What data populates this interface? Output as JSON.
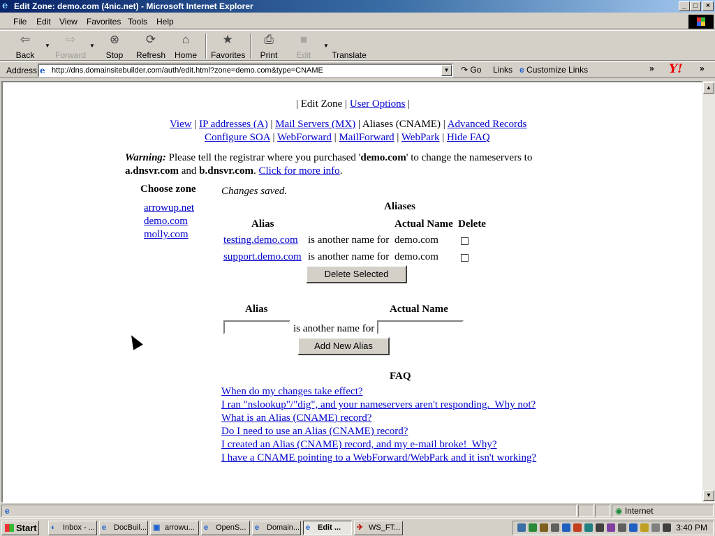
{
  "window": {
    "title": "Edit Zone: demo.com (4nic.net) - Microsoft Internet Explorer",
    "controls": [
      "_",
      "□",
      "×"
    ]
  },
  "menu": {
    "items": [
      "File",
      "Edit",
      "View",
      "Favorites",
      "Tools",
      "Help"
    ]
  },
  "toolbar": {
    "back": "Back",
    "forward": "Forward",
    "stop": "Stop",
    "refresh": "Refresh",
    "home": "Home",
    "favorites": "Favorites",
    "print": "Print",
    "edit": "Edit",
    "translate": "Translate"
  },
  "address": {
    "label": "Address",
    "url": "http://dns.domainsitebuilder.com/auth/edit.html?zone=demo.com&type=CNAME",
    "go": "Go",
    "links": "Links",
    "customize": "Customize Links"
  },
  "page": {
    "top_nav": {
      "sep1": "| Edit Zone |",
      "user_options": "User Options",
      "sep2": "|"
    },
    "nav": {
      "view": "View",
      "ip": "IP addresses (A)",
      "mx": "Mail Servers (MX)",
      "aliases": "Aliases (CNAME)",
      "advanced": "Advanced Records",
      "soa": "Configure SOA",
      "webforward": "WebForward",
      "mailforward": "MailForward",
      "webpark": "WebPark",
      "hidefaq": "Hide FAQ"
    },
    "warning": {
      "label": "Warning:",
      "text1": " Please tell the registrar where you purchased '",
      "domain": "demo.com",
      "text2": "' to change the nameservers to",
      "ns1": "a.dnsvr.com",
      "and": " and ",
      "ns2": "b.dnsvr.com",
      "period": ".",
      "more": "Click for more info"
    },
    "zones": {
      "heading": "Choose zone",
      "items": [
        "arrowup.net",
        "demo.com",
        "molly.com"
      ]
    },
    "status": "Changes saved.",
    "aliases_table": {
      "heading": "Aliases",
      "col_alias": "Alias",
      "col_actual": "Actual Name",
      "col_delete": "Delete",
      "rows": [
        {
          "alias": "testing.demo.com",
          "mid": "is another name for",
          "actual": "demo.com"
        },
        {
          "alias": "support.demo.com",
          "mid": "is another name for",
          "actual": "demo.com"
        }
      ],
      "delete_button": "Delete Selected"
    },
    "new_alias": {
      "col_alias": "Alias",
      "col_actual": "Actual Name",
      "mid": "is another name for",
      "alias_value": "",
      "actual_value": "",
      "add_button": "Add New Alias"
    },
    "faq": {
      "heading": "FAQ",
      "items": [
        "When do my changes take effect?",
        "I ran \"nslookup\"/\"dig\", and your nameservers aren't responding.  Why not?",
        "What is an Alias (CNAME) record?",
        "Do I need to use an Alias (CNAME) record?",
        "I created an Alias (CNAME) record, and my e-mail broke!  Why?",
        "I have a CNAME pointing to a WebForward/WebPark and it isn't working?"
      ]
    }
  },
  "status_bar": {
    "zone": "Internet"
  },
  "taskbar": {
    "start": "Start",
    "tasks": [
      "Inbox - ...",
      "DocBuil...",
      "arrowu...",
      "OpenS...",
      "Domain...",
      "Edit ...",
      "WS_FT..."
    ],
    "clock": "3:40 PM"
  },
  "colors": {
    "link": "#0000cc",
    "title_start": "#0a246a",
    "title_end": "#a6caf0",
    "chrome": "#d4d0c8"
  }
}
